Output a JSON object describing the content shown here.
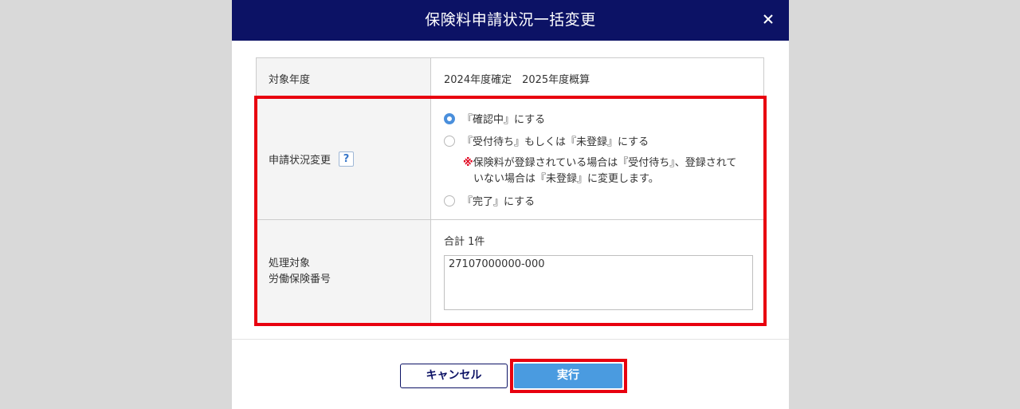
{
  "dialog": {
    "title": "保険料申請状況一括変更"
  },
  "form": {
    "target_year": {
      "label": "対象年度",
      "value": "2024年度確定　2025年度概算"
    },
    "status_change": {
      "label": "申請状況変更",
      "help_glyph": "?",
      "options": [
        {
          "label": "『確認中』にする",
          "selected": true
        },
        {
          "label": "『受付待ち』もしくは『未登録』にする",
          "selected": false
        },
        {
          "label": "『完了』にする",
          "selected": false
        }
      ],
      "note": {
        "mark": "※",
        "line1": "保険料が登録されている場合は『受付待ち』、登録されて",
        "line2": "いない場合は『未登録』に変更します。"
      }
    },
    "target_numbers": {
      "label_line1": "処理対象",
      "label_line2": "労働保険番号",
      "total": "合計 1件",
      "value": "27107000000-000"
    }
  },
  "buttons": {
    "cancel": "キャンセル",
    "execute": "実行"
  },
  "colors": {
    "header_bg": "#0c1265",
    "highlight": "#e8000f",
    "primary_button": "#4a9be0",
    "radio_checked": "#4a8fdc"
  }
}
